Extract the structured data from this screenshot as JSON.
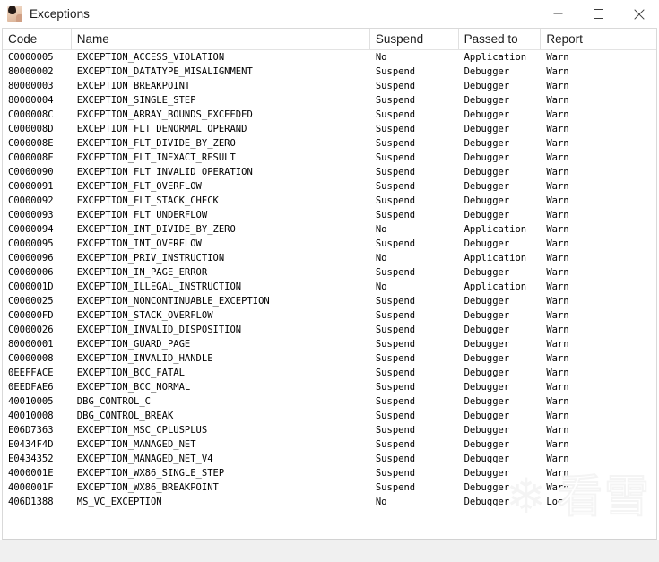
{
  "window": {
    "title": "Exceptions",
    "icon": "avatar-icon",
    "controls": {
      "minimize": "minimize-icon",
      "maximize": "maximize-icon",
      "close": "close-icon"
    }
  },
  "table": {
    "columns": [
      "Code",
      "Name",
      "Suspend",
      "Passed to",
      "Report"
    ],
    "rows": [
      {
        "code": "C0000005",
        "name": "EXCEPTION_ACCESS_VIOLATION",
        "suspend": "No",
        "passed_to": "Application",
        "report": "Warn"
      },
      {
        "code": "80000002",
        "name": "EXCEPTION_DATATYPE_MISALIGNMENT",
        "suspend": "Suspend",
        "passed_to": "Debugger",
        "report": "Warn"
      },
      {
        "code": "80000003",
        "name": "EXCEPTION_BREAKPOINT",
        "suspend": "Suspend",
        "passed_to": "Debugger",
        "report": "Warn"
      },
      {
        "code": "80000004",
        "name": "EXCEPTION_SINGLE_STEP",
        "suspend": "Suspend",
        "passed_to": "Debugger",
        "report": "Warn"
      },
      {
        "code": "C000008C",
        "name": "EXCEPTION_ARRAY_BOUNDS_EXCEEDED",
        "suspend": "Suspend",
        "passed_to": "Debugger",
        "report": "Warn"
      },
      {
        "code": "C000008D",
        "name": "EXCEPTION_FLT_DENORMAL_OPERAND",
        "suspend": "Suspend",
        "passed_to": "Debugger",
        "report": "Warn"
      },
      {
        "code": "C000008E",
        "name": "EXCEPTION_FLT_DIVIDE_BY_ZERO",
        "suspend": "Suspend",
        "passed_to": "Debugger",
        "report": "Warn"
      },
      {
        "code": "C000008F",
        "name": "EXCEPTION_FLT_INEXACT_RESULT",
        "suspend": "Suspend",
        "passed_to": "Debugger",
        "report": "Warn"
      },
      {
        "code": "C0000090",
        "name": "EXCEPTION_FLT_INVALID_OPERATION",
        "suspend": "Suspend",
        "passed_to": "Debugger",
        "report": "Warn"
      },
      {
        "code": "C0000091",
        "name": "EXCEPTION_FLT_OVERFLOW",
        "suspend": "Suspend",
        "passed_to": "Debugger",
        "report": "Warn"
      },
      {
        "code": "C0000092",
        "name": "EXCEPTION_FLT_STACK_CHECK",
        "suspend": "Suspend",
        "passed_to": "Debugger",
        "report": "Warn"
      },
      {
        "code": "C0000093",
        "name": "EXCEPTION_FLT_UNDERFLOW",
        "suspend": "Suspend",
        "passed_to": "Debugger",
        "report": "Warn"
      },
      {
        "code": "C0000094",
        "name": "EXCEPTION_INT_DIVIDE_BY_ZERO",
        "suspend": "No",
        "passed_to": "Application",
        "report": "Warn"
      },
      {
        "code": "C0000095",
        "name": "EXCEPTION_INT_OVERFLOW",
        "suspend": "Suspend",
        "passed_to": "Debugger",
        "report": "Warn"
      },
      {
        "code": "C0000096",
        "name": "EXCEPTION_PRIV_INSTRUCTION",
        "suspend": "No",
        "passed_to": "Application",
        "report": "Warn"
      },
      {
        "code": "C0000006",
        "name": "EXCEPTION_IN_PAGE_ERROR",
        "suspend": "Suspend",
        "passed_to": "Debugger",
        "report": "Warn"
      },
      {
        "code": "C000001D",
        "name": "EXCEPTION_ILLEGAL_INSTRUCTION",
        "suspend": "No",
        "passed_to": "Application",
        "report": "Warn"
      },
      {
        "code": "C0000025",
        "name": "EXCEPTION_NONCONTINUABLE_EXCEPTION",
        "suspend": "Suspend",
        "passed_to": "Debugger",
        "report": "Warn"
      },
      {
        "code": "C00000FD",
        "name": "EXCEPTION_STACK_OVERFLOW",
        "suspend": "Suspend",
        "passed_to": "Debugger",
        "report": "Warn"
      },
      {
        "code": "C0000026",
        "name": "EXCEPTION_INVALID_DISPOSITION",
        "suspend": "Suspend",
        "passed_to": "Debugger",
        "report": "Warn"
      },
      {
        "code": "80000001",
        "name": "EXCEPTION_GUARD_PAGE",
        "suspend": "Suspend",
        "passed_to": "Debugger",
        "report": "Warn"
      },
      {
        "code": "C0000008",
        "name": "EXCEPTION_INVALID_HANDLE",
        "suspend": "Suspend",
        "passed_to": "Debugger",
        "report": "Warn"
      },
      {
        "code": "0EEFFACE",
        "name": "EXCEPTION_BCC_FATAL",
        "suspend": "Suspend",
        "passed_to": "Debugger",
        "report": "Warn"
      },
      {
        "code": "0EEDFAE6",
        "name": "EXCEPTION_BCC_NORMAL",
        "suspend": "Suspend",
        "passed_to": "Debugger",
        "report": "Warn"
      },
      {
        "code": "40010005",
        "name": "DBG_CONTROL_C",
        "suspend": "Suspend",
        "passed_to": "Debugger",
        "report": "Warn"
      },
      {
        "code": "40010008",
        "name": "DBG_CONTROL_BREAK",
        "suspend": "Suspend",
        "passed_to": "Debugger",
        "report": "Warn"
      },
      {
        "code": "E06D7363",
        "name": "EXCEPTION_MSC_CPLUSPLUS",
        "suspend": "Suspend",
        "passed_to": "Debugger",
        "report": "Warn"
      },
      {
        "code": "E0434F4D",
        "name": "EXCEPTION_MANAGED_NET",
        "suspend": "Suspend",
        "passed_to": "Debugger",
        "report": "Warn"
      },
      {
        "code": "E0434352",
        "name": "EXCEPTION_MANAGED_NET_V4",
        "suspend": "Suspend",
        "passed_to": "Debugger",
        "report": "Warn"
      },
      {
        "code": "4000001E",
        "name": "EXCEPTION_WX86_SINGLE_STEP",
        "suspend": "Suspend",
        "passed_to": "Debugger",
        "report": "Warn"
      },
      {
        "code": "4000001F",
        "name": "EXCEPTION_WX86_BREAKPOINT",
        "suspend": "Suspend",
        "passed_to": "Debugger",
        "report": "Warn"
      },
      {
        "code": "406D1388",
        "name": "MS_VC_EXCEPTION",
        "suspend": "No",
        "passed_to": "Debugger",
        "report": "Log"
      }
    ]
  },
  "watermark": {
    "snowflake": "❄",
    "text": "看雪"
  }
}
